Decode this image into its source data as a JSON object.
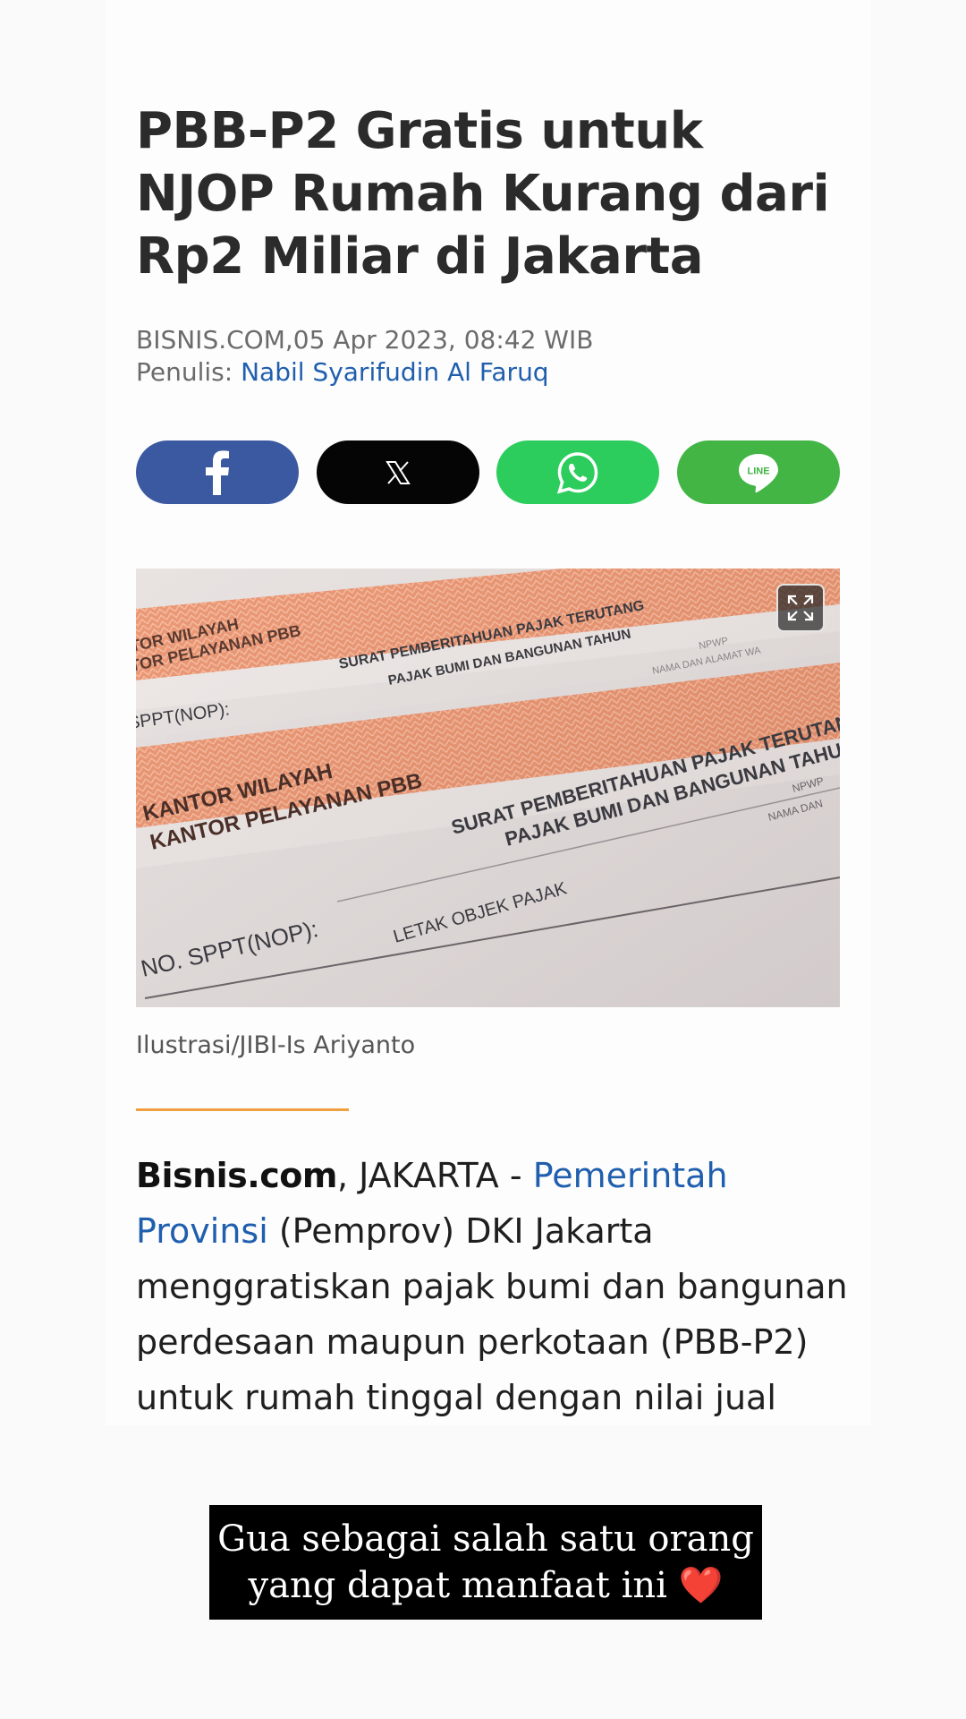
{
  "article": {
    "title": "PBB-P2 Gratis untuk NJOP Rumah Kurang dari Rp2 Miliar di Jakarta",
    "meta": {
      "source_date": "BISNIS.COM,05 Apr 2023, 08:42 WIB",
      "author_label": "Penulis:",
      "author_name": "Nabil Syarifudin Al Faruq"
    },
    "share_buttons": [
      {
        "name": "facebook",
        "icon": "facebook-icon",
        "color": "#3b59a0"
      },
      {
        "name": "x",
        "icon": "x-icon",
        "color": "#050505"
      },
      {
        "name": "whatsapp",
        "icon": "whatsapp-icon",
        "color": "#2ccd5d"
      },
      {
        "name": "line",
        "icon": "line-icon",
        "label": "LINE",
        "color": "#42b545"
      }
    ],
    "image": {
      "caption": "Ilustrasi/JIBI-Is Ariyanto",
      "photo_text": {
        "office_top_1": "TOR WILAYAH",
        "office_top_2": "TOR PELAYANAN PBB",
        "notice_top_1": "SURAT PEMBERITAHUAN PAJAK TERUTANG",
        "notice_top_2": "PAJAK BUMI DAN BANGUNAN TAHUN",
        "npwp_top": "NPWP",
        "addr_top": "NAMA DAN ALAMAT WA",
        "nop_top": "SPPT(NOP):",
        "office_1": "KANTOR WILAYAH",
        "office_2": "KANTOR PELAYANAN PBB",
        "notice_1": "SURAT PEMBERITAHUAN PAJAK TERUTANG",
        "notice_2": "PAJAK BUMI DAN BANGUNAN TAHUN",
        "npwp": "NPWP",
        "name": "NAMA DAN",
        "nop": "NO. SPPT(NOP):",
        "location": "LETAK OBJEK PAJAK"
      }
    },
    "body": {
      "source": "Bisnis.com",
      "dateline": ", JAKARTA - ",
      "link_text": "Pemerintah Provinsi",
      "text": " (Pemprov) DKI Jakarta menggratiskan pajak bumi dan bangunan perdesaan maupun perkotaan (PBB-P2) untuk rumah tinggal dengan nilai jual"
    }
  },
  "story_overlay": {
    "line1": "Gua sebagai salah satu orang",
    "line2": "yang dapat manfaat ini",
    "emoji": "❤️",
    "emoji_name": "red-heart-icon"
  },
  "colors": {
    "link": "#1f5fae",
    "divider": "#f0a040",
    "stamp_orange": "#e8875e"
  }
}
